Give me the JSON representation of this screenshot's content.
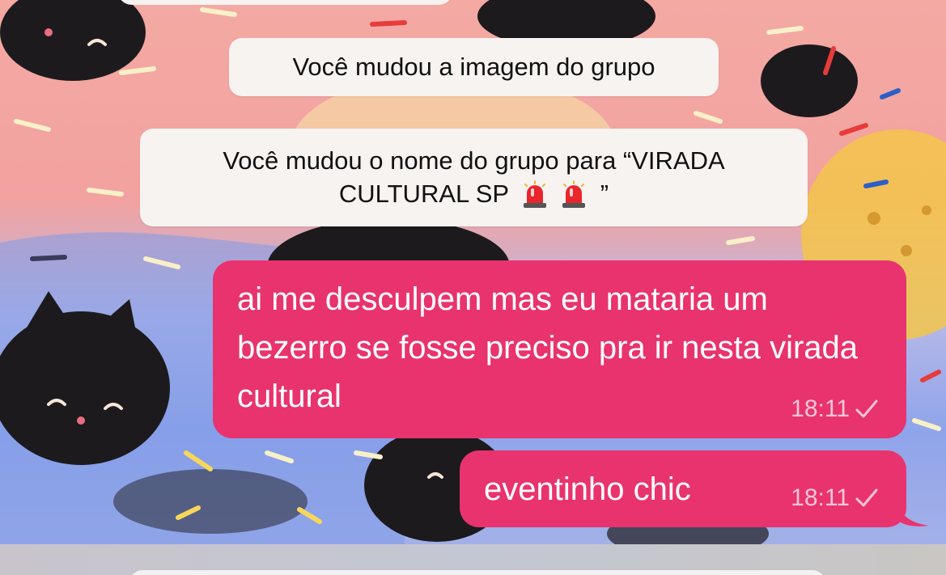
{
  "chat": {
    "system_messages": [
      {
        "text": "Você mudou a imagem do grupo"
      },
      {
        "text_line1": "Você mudou o nome do grupo para “VIRADA",
        "text_line2_prefix": "CULTURAL SP",
        "text_line2_suffix": "”",
        "emoji": [
          "police-siren",
          "police-siren"
        ]
      }
    ],
    "outgoing_messages": [
      {
        "text": "ai me desculpem mas eu mataria um bezerro se fosse preciso pra ir nesta virada cultural",
        "time": "18:11",
        "status": "sent-check"
      },
      {
        "text": "eventinho chic",
        "time": "18:11",
        "status": "sent-check"
      }
    ]
  },
  "colors": {
    "outgoing_bubble": "#e8336f",
    "system_bubble": "#f7f3f1",
    "wallpaper_pink": "#f4a9a3",
    "wallpaper_blue": "#8fa4ea"
  },
  "icons": [
    "check-icon",
    "police-siren-icon"
  ]
}
